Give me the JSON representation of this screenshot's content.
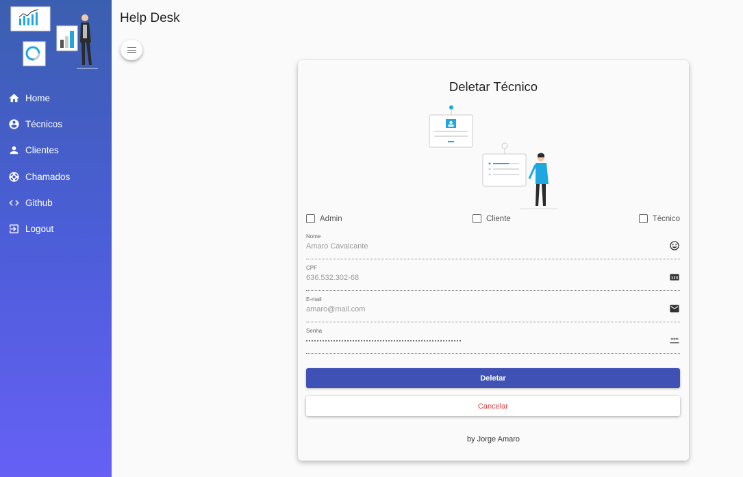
{
  "app": {
    "title": "Help Desk"
  },
  "sidebar": {
    "items": [
      {
        "label": "Home",
        "icon": "home-icon"
      },
      {
        "label": "Técnicos",
        "icon": "account-circle-icon"
      },
      {
        "label": "Clientes",
        "icon": "person-icon"
      },
      {
        "label": "Chamados",
        "icon": "lifebuoy-icon"
      },
      {
        "label": "Github",
        "icon": "code-icon"
      },
      {
        "label": "Logout",
        "icon": "logout-icon"
      }
    ]
  },
  "card": {
    "title": "Deletar Técnico",
    "profiles": [
      {
        "label": "Admin",
        "checked": false
      },
      {
        "label": "Cliente",
        "checked": false
      },
      {
        "label": "Técnico",
        "checked": false
      }
    ],
    "fields": {
      "nome": {
        "label": "Nome",
        "value": "Amaro Cavalcante",
        "icon": "smile-icon"
      },
      "cpf": {
        "label": "CPF",
        "value": "636.532.302-68",
        "icon": "numbers-icon"
      },
      "email": {
        "label": "E-mail",
        "value": "amaro@mail.com",
        "icon": "mail-icon"
      },
      "senha": {
        "label": "Senha",
        "icon": "password-icon"
      }
    },
    "delete_label": "Deletar",
    "cancel_label": "Cancelar",
    "footer": "by Jorge Amaro"
  },
  "colors": {
    "primary": "#3f51b5",
    "cancel": "#e53935",
    "sidebar_top": "#3b5fb0",
    "sidebar_bottom": "#6660f5",
    "illustration_accent": "#1ea7e1"
  }
}
